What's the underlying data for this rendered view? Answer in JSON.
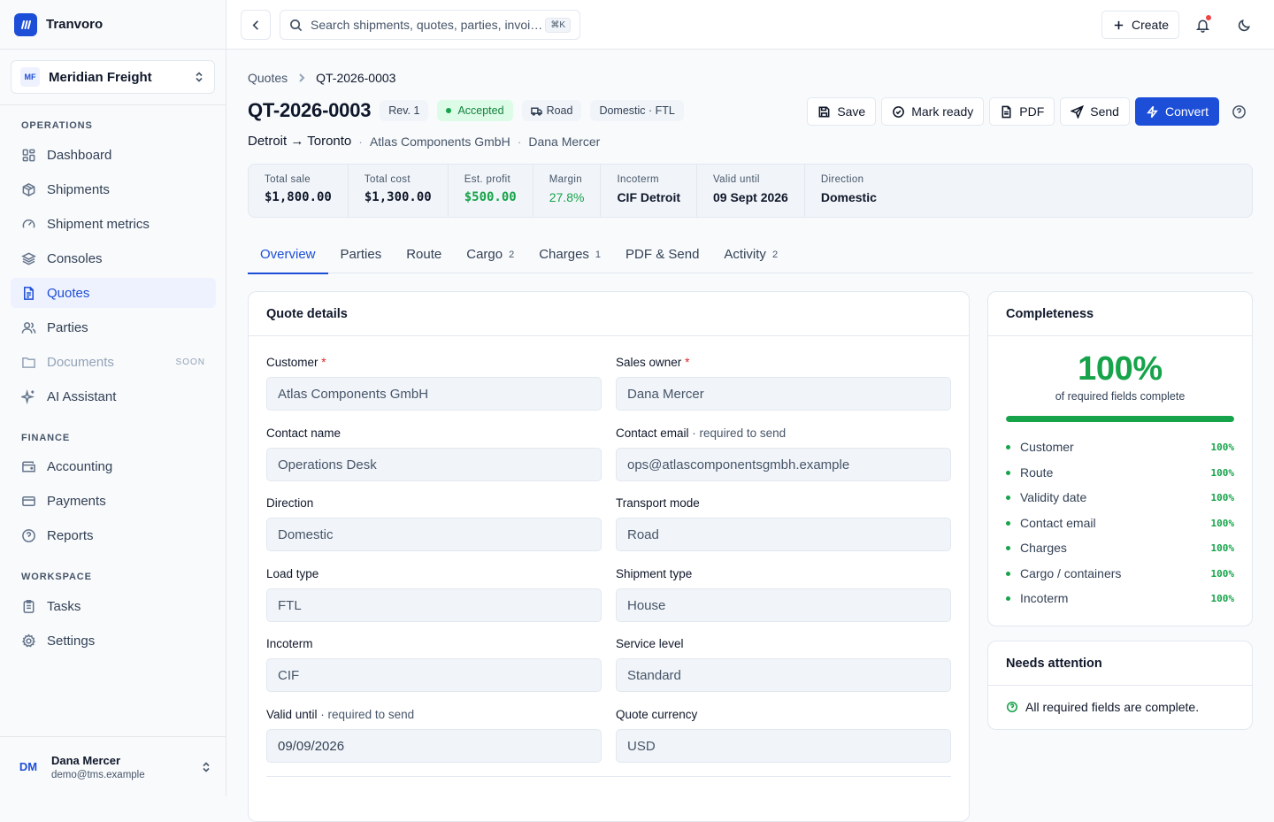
{
  "app": {
    "name": "Tranvoro"
  },
  "org": {
    "initials": "MF",
    "name": "Meridian Freight"
  },
  "nav": {
    "operations_label": "OPERATIONS",
    "finance_label": "FINANCE",
    "workspace_label": "WORKSPACE",
    "items": [
      {
        "label": "Dashboard"
      },
      {
        "label": "Shipments"
      },
      {
        "label": "Shipment metrics"
      },
      {
        "label": "Consoles"
      },
      {
        "label": "Quotes"
      },
      {
        "label": "Parties"
      },
      {
        "label": "Documents",
        "badge": "SOON"
      },
      {
        "label": "AI Assistant"
      },
      {
        "label": "Accounting"
      },
      {
        "label": "Payments"
      },
      {
        "label": "Reports"
      },
      {
        "label": "Tasks"
      },
      {
        "label": "Settings"
      }
    ]
  },
  "user": {
    "initials": "DM",
    "name": "Dana Mercer",
    "email": "demo@tms.example"
  },
  "topbar": {
    "search_placeholder": "Search shipments, quotes, parties, invoi…",
    "shortcut": "⌘K",
    "create_label": "Create"
  },
  "breadcrumb": {
    "parent": "Quotes",
    "current": "QT-2026-0003"
  },
  "quote": {
    "id": "QT-2026-0003",
    "revision": "Rev. 1",
    "status": "Accepted",
    "mode": "Road",
    "scope": "Domestic · FTL",
    "route": "Detroit → Toronto",
    "customer": "Atlas Components GmbH",
    "owner": "Dana Mercer"
  },
  "actions": {
    "save": "Save",
    "mark_ready": "Mark ready",
    "pdf": "PDF",
    "send": "Send",
    "convert": "Convert"
  },
  "stats": [
    {
      "label": "Total sale",
      "value": "$1,800.00",
      "mono": true
    },
    {
      "label": "Total cost",
      "value": "$1,300.00",
      "mono": true
    },
    {
      "label": "Est. profit",
      "value": "$500.00",
      "mono": true,
      "green": true
    },
    {
      "label": "Margin",
      "value": "27.8%",
      "green": true
    },
    {
      "label": "Incoterm",
      "value": "CIF Detroit"
    },
    {
      "label": "Valid until",
      "value": "09 Sept 2026"
    },
    {
      "label": "Direction",
      "value": "Domestic"
    }
  ],
  "tabs": [
    {
      "label": "Overview",
      "count": ""
    },
    {
      "label": "Parties",
      "count": ""
    },
    {
      "label": "Route",
      "count": ""
    },
    {
      "label": "Cargo",
      "count": "2"
    },
    {
      "label": "Charges",
      "count": "1"
    },
    {
      "label": "PDF & Send",
      "count": ""
    },
    {
      "label": "Activity",
      "count": "2"
    }
  ],
  "details": {
    "title": "Quote details",
    "fields": [
      {
        "label": "Customer",
        "required": "*",
        "hint": "",
        "value": "Atlas Components GmbH"
      },
      {
        "label": "Sales owner",
        "required": "*",
        "hint": "",
        "value": "Dana Mercer"
      },
      {
        "label": "Contact name",
        "required": "",
        "hint": "",
        "value": "Operations Desk"
      },
      {
        "label": "Contact email",
        "required": "",
        "hint": " · required to send",
        "value": "ops@atlascomponentsgmbh.example"
      },
      {
        "label": "Direction",
        "required": "",
        "hint": "",
        "value": "Domestic"
      },
      {
        "label": "Transport mode",
        "required": "",
        "hint": "",
        "value": "Road"
      },
      {
        "label": "Load type",
        "required": "",
        "hint": "",
        "value": "FTL"
      },
      {
        "label": "Shipment type",
        "required": "",
        "hint": "",
        "value": "House"
      },
      {
        "label": "Incoterm",
        "required": "",
        "hint": "",
        "value": "CIF"
      },
      {
        "label": "Service level",
        "required": "",
        "hint": "",
        "value": "Standard"
      },
      {
        "label": "Valid until",
        "required": "",
        "hint": " · required to send",
        "value": "09/09/2026"
      },
      {
        "label": "Quote currency",
        "required": "",
        "hint": "",
        "value": "USD"
      }
    ]
  },
  "completeness": {
    "title": "Completeness",
    "percent": "100%",
    "fraction": 1.0,
    "subtitle": "of required fields complete",
    "items": [
      {
        "label": "Customer",
        "value": "100%"
      },
      {
        "label": "Route",
        "value": "100%"
      },
      {
        "label": "Validity date",
        "value": "100%"
      },
      {
        "label": "Contact email",
        "value": "100%"
      },
      {
        "label": "Charges",
        "value": "100%"
      },
      {
        "label": "Cargo / containers",
        "value": "100%"
      },
      {
        "label": "Incoterm",
        "value": "100%"
      }
    ]
  },
  "attention": {
    "title": "Needs attention",
    "message": "All required fields are complete."
  }
}
